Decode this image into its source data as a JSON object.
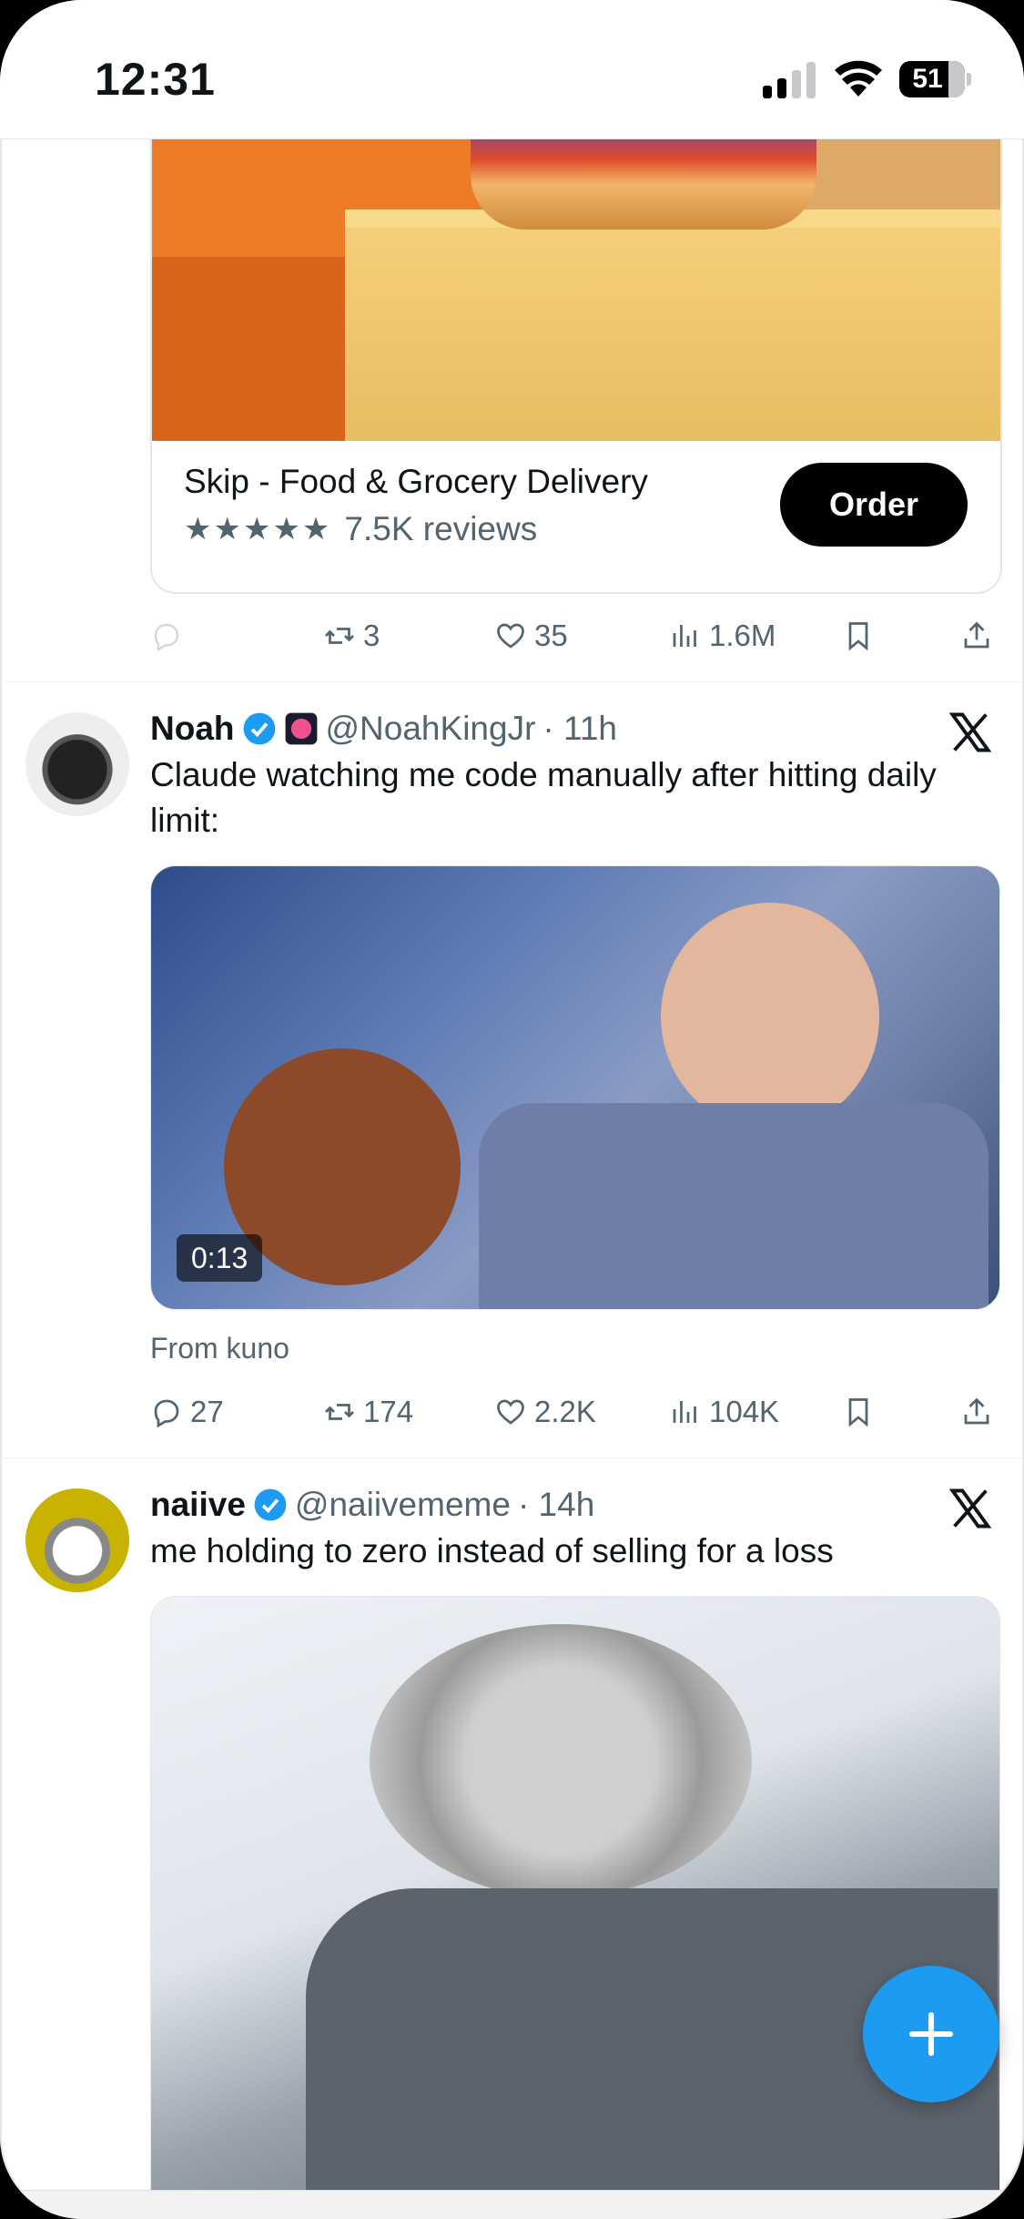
{
  "status_bar": {
    "time": "12:31",
    "battery": "51"
  },
  "ad": {
    "title": "Skip - Food & Grocery Delivery",
    "stars": "★★★★★",
    "reviews": "7.5K reviews",
    "order_label": "Order",
    "stats": {
      "retweets": "3",
      "likes": "35",
      "views": "1.6M"
    }
  },
  "tweets": [
    {
      "name": "Noah",
      "handle": "@NoahKingJr",
      "time": "· 11h",
      "text": "Claude watching me code manually after hitting daily limit:",
      "video_duration": "0:13",
      "from": "From kuno",
      "stats": {
        "replies": "27",
        "retweets": "174",
        "likes": "2.2K",
        "views": "104K"
      }
    },
    {
      "name": "naiive",
      "handle": "@naiivememe",
      "time": "· 14h",
      "text": "me holding to zero instead of selling for a loss"
    }
  ],
  "colors": {
    "accent": "#1d9bf0",
    "muted": "#536471",
    "text": "#0f1419"
  }
}
